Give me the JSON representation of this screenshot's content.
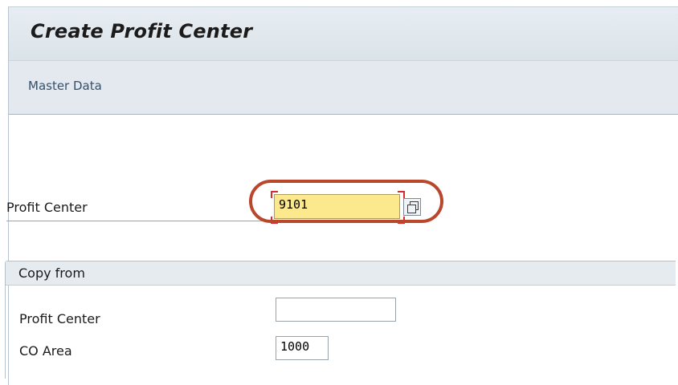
{
  "title": "Create Profit Center",
  "toolbar": {
    "master_data": "Master Data"
  },
  "main": {
    "profit_center_label": "Profit Center",
    "profit_center_value": "9101"
  },
  "copy_from": {
    "title": "Copy from",
    "profit_center_label": "Profit Center",
    "profit_center_value": "",
    "co_area_label": "CO Area",
    "co_area_value": "1000"
  },
  "colors": {
    "required_field_bg": "#fce98e",
    "highlight_oval": "#b8472c",
    "required_marker": "#d82d2d"
  },
  "icons": {
    "value_help": "value-help-icon"
  }
}
